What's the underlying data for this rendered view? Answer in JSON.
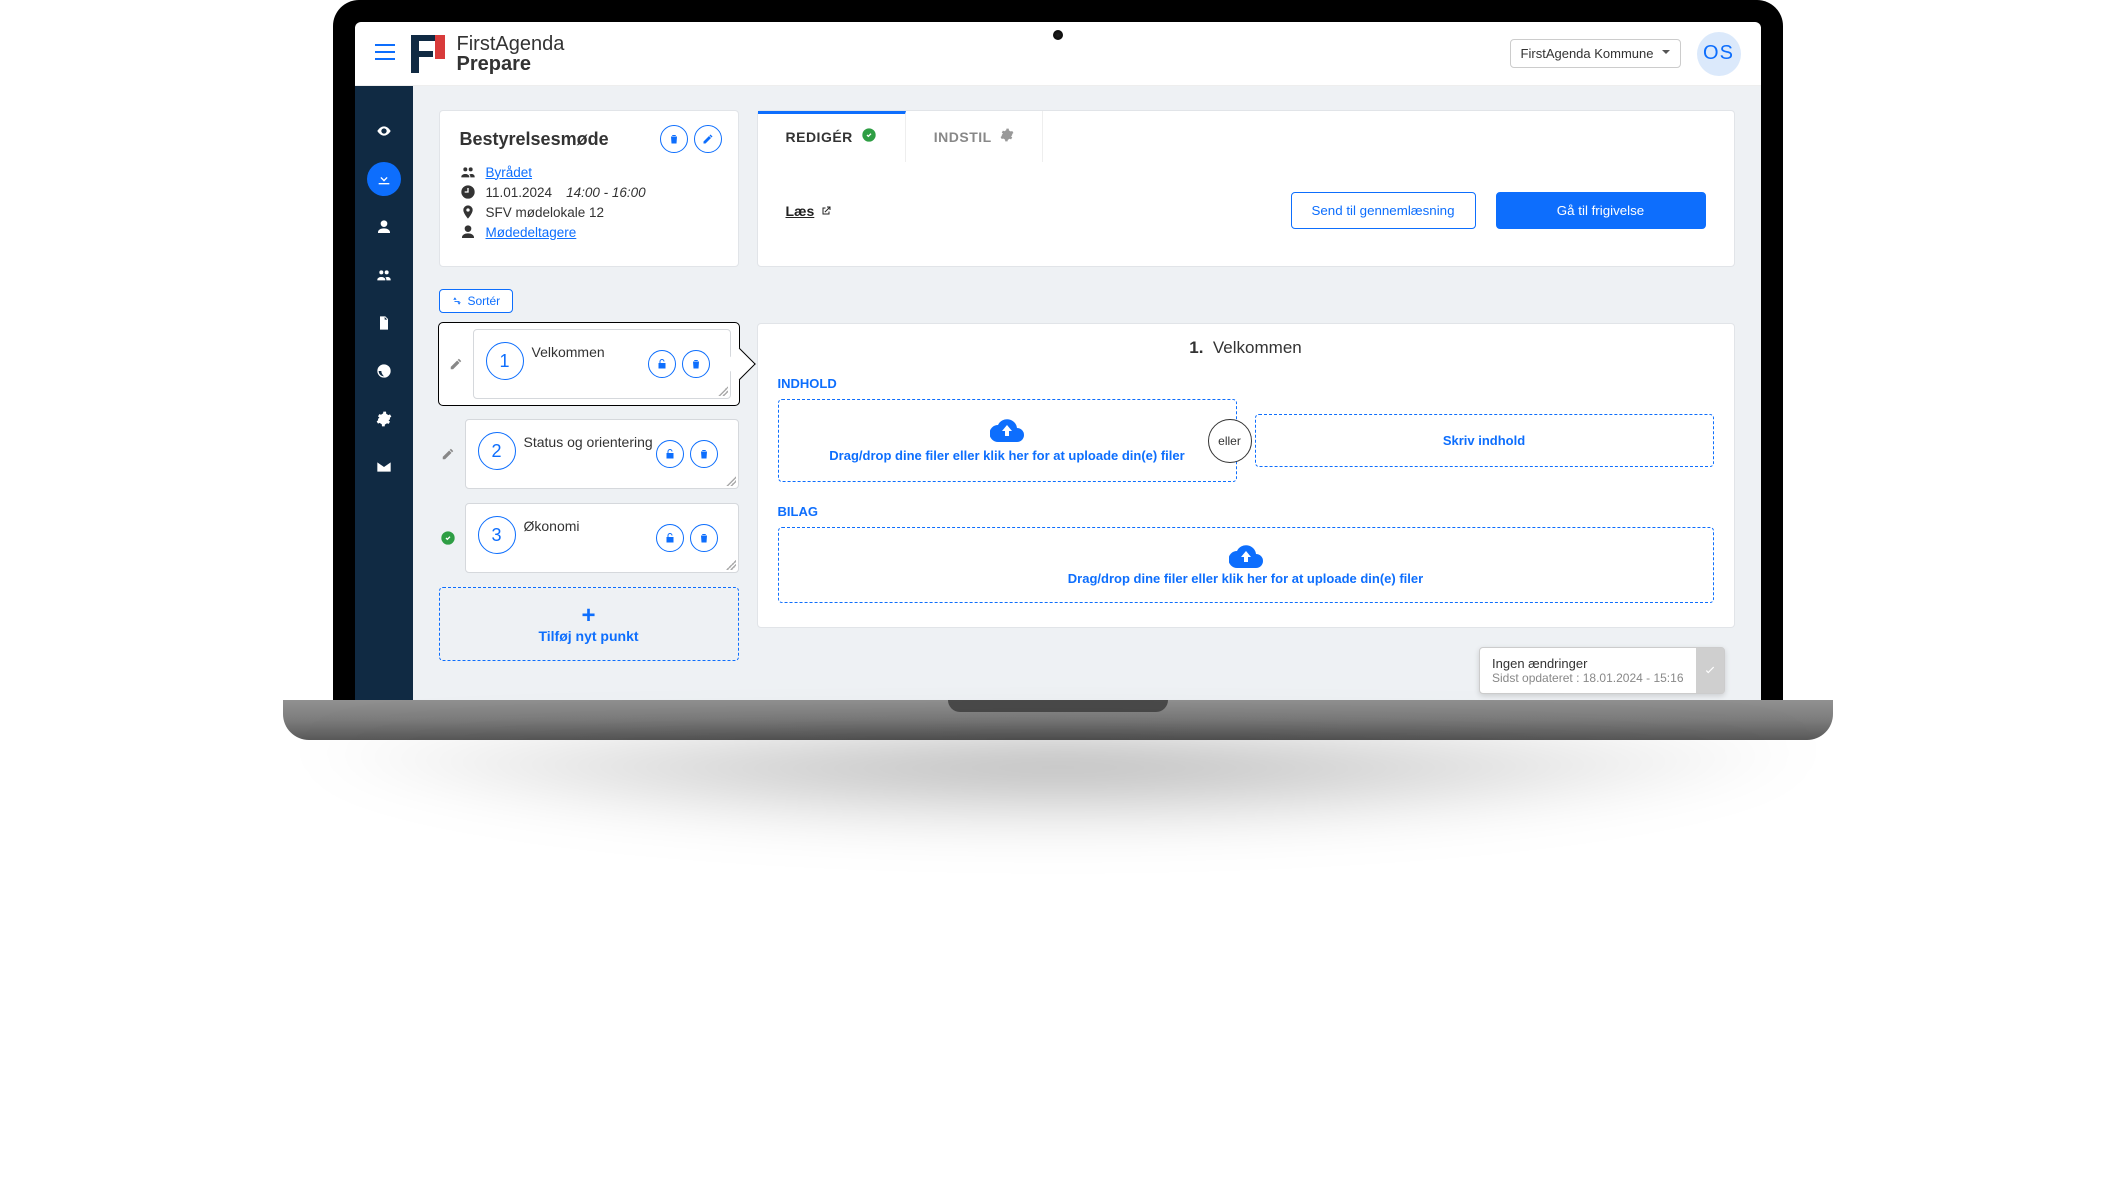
{
  "header": {
    "brand_line1": "FirstAgenda",
    "brand_line2": "Prepare",
    "org_selected": "FirstAgenda Kommune",
    "avatar_initials": "OS"
  },
  "sidebar": {
    "items": [
      "view",
      "download",
      "user",
      "group",
      "file",
      "globe",
      "settings",
      "mail"
    ],
    "active_index": 1
  },
  "meeting": {
    "title": "Bestyrelsesmøde",
    "committee": "Byrådet",
    "date": "11.01.2024",
    "time": "14:00 - 16:00",
    "location": "SFV mødelokale 12",
    "participants_label": "Mødedeltagere"
  },
  "tabs": {
    "edit_label": "REDIGÉR",
    "settings_label": "INDSTIL",
    "read_label": "Læs",
    "send_review_label": "Send til gennemlæsning",
    "release_label": "Gå til frigivelse"
  },
  "sort_label": "Sortér",
  "agenda": {
    "items": [
      {
        "num": "1",
        "title": "Velkommen",
        "selected": true,
        "status": "edit"
      },
      {
        "num": "2",
        "title": "Status og orientering",
        "selected": false,
        "status": "edit"
      },
      {
        "num": "3",
        "title": "Økonomi",
        "selected": false,
        "status": "done"
      }
    ],
    "add_label": "Tilføj nyt punkt"
  },
  "detail": {
    "heading_num": "1.",
    "heading_title": "Velkommen",
    "content_label": "INDHOLD",
    "upload_text": "Drag/drop dine filer eller klik her for at uploade din(e) filer",
    "divider_label": "eller",
    "write_label": "Skriv indhold",
    "attachments_label": "BILAG",
    "attachments_text": "Drag/drop dine filer eller klik her for at uploade din(e) filer"
  },
  "toast": {
    "title": "Ingen ændringer",
    "sub": "Sidst opdateret : 18.01.2024 - 15:16"
  }
}
